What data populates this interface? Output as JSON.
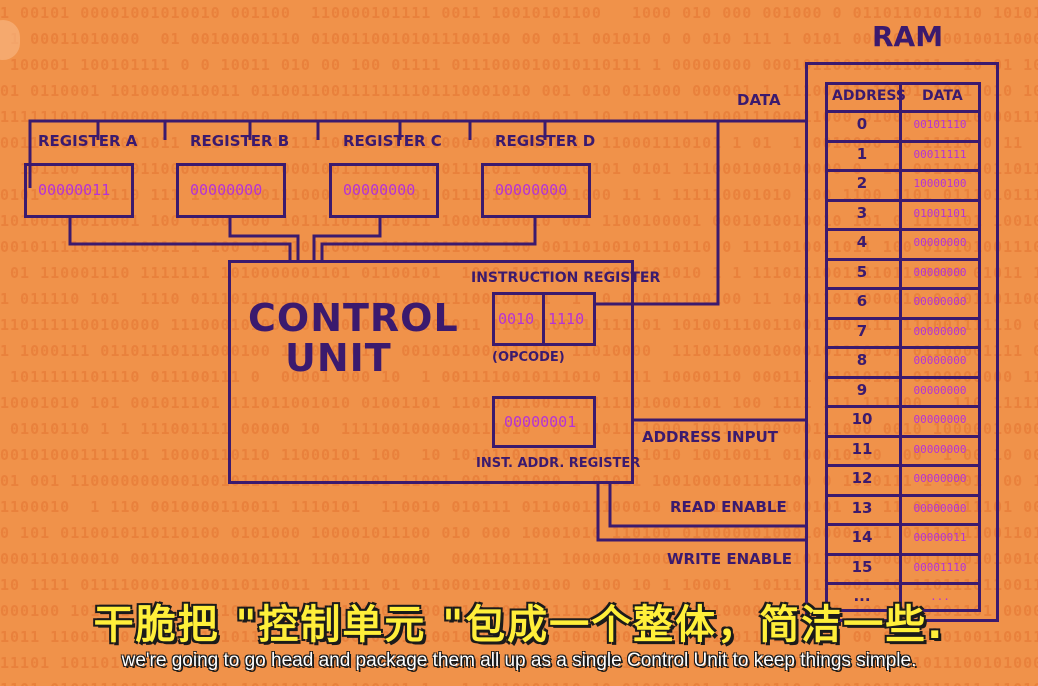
{
  "colors": {
    "background": "#f0924a",
    "wire": "#3b1a6e",
    "value": "#b533d6",
    "subtitle_zh": "#ffef3a",
    "subtitle_en": "#ffffff"
  },
  "registers": [
    {
      "label": "REGISTER A",
      "value": "00000011"
    },
    {
      "label": "REGISTER B",
      "value": "00000000"
    },
    {
      "label": "REGISTER C",
      "value": "00000000"
    },
    {
      "label": "REGISTER D",
      "value": "00000000"
    }
  ],
  "control_unit": {
    "title_line1": "CONTROL",
    "title_line2": "UNIT",
    "instruction_register_label": "INSTRUCTION REGISTER",
    "opcode": "0010",
    "address": "1110",
    "opcode_label": "(OPCODE)",
    "inst_addr_value": "00000001",
    "inst_addr_label": "INST. ADDR. REGISTER"
  },
  "bus_labels": {
    "data": "DATA",
    "address_input": "ADDRESS INPUT",
    "read_enable": "READ ENABLE",
    "write_enable": "WRITE ENABLE"
  },
  "ram": {
    "title": "RAM",
    "col_address": "ADDRESS",
    "col_data": "DATA",
    "rows": [
      {
        "address": "0",
        "data": "00101110"
      },
      {
        "address": "1",
        "data": "00011111"
      },
      {
        "address": "2",
        "data": "10000100"
      },
      {
        "address": "3",
        "data": "01001101"
      },
      {
        "address": "4",
        "data": "00000000"
      },
      {
        "address": "5",
        "data": "00000000"
      },
      {
        "address": "6",
        "data": "00000000"
      },
      {
        "address": "7",
        "data": "00000000"
      },
      {
        "address": "8",
        "data": "00000000"
      },
      {
        "address": "9",
        "data": "00000000"
      },
      {
        "address": "10",
        "data": "00000000"
      },
      {
        "address": "11",
        "data": "00000000"
      },
      {
        "address": "12",
        "data": "00000000"
      },
      {
        "address": "13",
        "data": "00000000"
      },
      {
        "address": "14",
        "data": "00000011"
      },
      {
        "address": "15",
        "data": "00001110"
      },
      {
        "address": "...",
        "data": "..."
      }
    ]
  },
  "subtitles": {
    "zh": "干脆把 \"控制单元 \"包成一个整体，简洁一些.",
    "en": "we're going to go head and package them all up as a single Control Unit to keep things simple."
  }
}
